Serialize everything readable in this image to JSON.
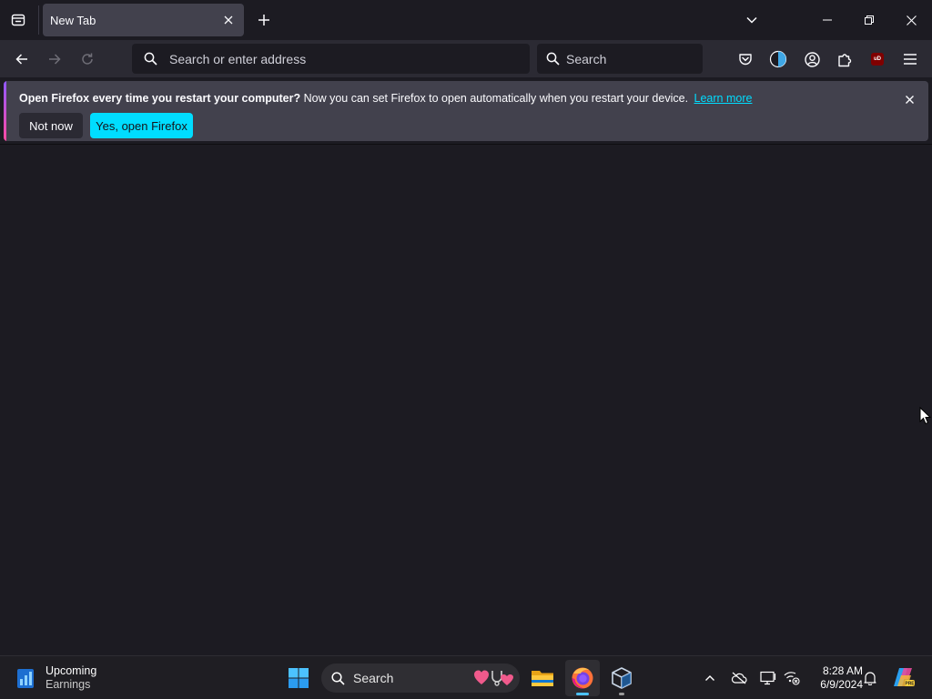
{
  "browser": {
    "tabs": [
      {
        "title": "New Tab",
        "active": true
      }
    ],
    "urlbar": {
      "placeholder": "Search or enter address",
      "value": ""
    },
    "searchbar": {
      "placeholder": "Search",
      "value": ""
    },
    "toolbar_icons": [
      "pocket-icon",
      "dark-reader-icon",
      "account-icon",
      "extensions-icon",
      "ublock-origin-icon",
      "menu-icon"
    ],
    "ublock_badge": "uD"
  },
  "notification": {
    "bold_text": "Open Firefox every time you restart your computer?",
    "text": "Now you can set Firefox to open automatically when you restart your device.",
    "link": "Learn more",
    "buttons": {
      "secondary": "Not now",
      "primary": "Yes, open Firefox"
    }
  },
  "taskbar": {
    "widget": {
      "title": "Upcoming",
      "subtitle": "Earnings"
    },
    "search_label": "Search",
    "apps": [
      {
        "name": "file-explorer",
        "active": false
      },
      {
        "name": "firefox",
        "active": true
      },
      {
        "name": "virtualbox",
        "active": false
      }
    ],
    "clock": {
      "time": "8:28 AM",
      "date": "6/9/2024"
    }
  },
  "colors": {
    "accent": "#00ddff",
    "tab_active_bg": "#42414d",
    "toolbar_bg": "#2b2a33",
    "content_bg": "#1c1b22"
  }
}
